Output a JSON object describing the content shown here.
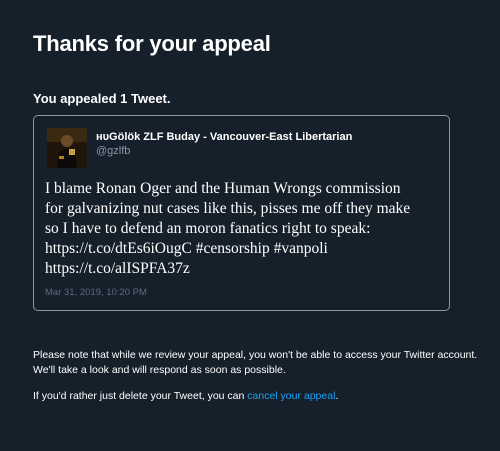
{
  "page": {
    "title": "Thanks for your appeal",
    "appeal_count": "You appealed 1 Tweet."
  },
  "tweet": {
    "author_name": "ʜᴜGölök ZLF Buday - Vancouver-East Libertarian",
    "author_handle": "@gzlfb",
    "text_lines": [
      "I blame Ronan Oger and the Human Wrongs commission",
      "for galvanizing nut cases like this, pisses me off they make",
      "so I have to defend an moron fanatics right to speak:",
      "https://t.co/dtEs6iOugC #censorship #vanpoli",
      "https://t.co/alISPFA37z"
    ],
    "timestamp": "Mar 31, 2019, 10:20 PM"
  },
  "notice": {
    "review_note": "Please note that while we review your appeal, you won't be able to access your Twitter account. We'll take a look and will respond as soon as possible.",
    "delete_prefix": "If you'd rather just delete your Tweet, you can ",
    "cancel_link": "cancel your appeal",
    "delete_suffix": "."
  },
  "colors": {
    "background": "#15202b",
    "link": "#1da1f2",
    "muted": "#8899a6"
  }
}
